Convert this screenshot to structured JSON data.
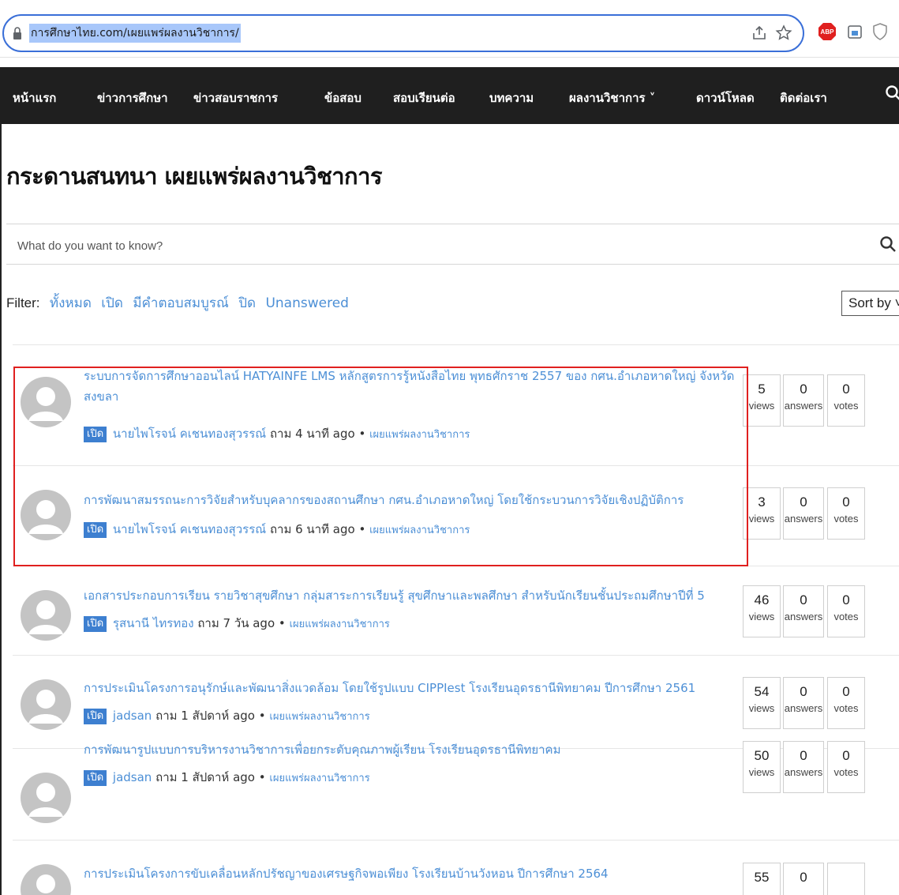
{
  "browser": {
    "url": "การศึกษาไทย.com/เผยแพร่ผลงานวิชาการ/",
    "icons": [
      "lock-icon",
      "share-icon",
      "star-icon",
      "adblock-icon",
      "extension-icon",
      "shield-icon"
    ]
  },
  "nav": {
    "items": [
      "หน้าแรก",
      "ข่าวการศึกษา",
      "ข่าวสอบราชการ",
      "ข้อสอบ",
      "สอบเรียนต่อ",
      "บทความ",
      "ผลงานวิชาการ ˅",
      "ดาวน์โหลด",
      "ติดต่อเรา"
    ]
  },
  "page": {
    "title": "กระดานสนทนา เผยแพร่ผลงานวิชาการ"
  },
  "search": {
    "placeholder": "What do you want to know?"
  },
  "filter": {
    "label": "Filter:",
    "options": [
      "ทั้งหมด",
      "เปิด",
      "มีคำตอบสมบูรณ์",
      "ปิด",
      "Unanswered"
    ],
    "sort_label": "Sort by ˅"
  },
  "questions": [
    {
      "title": "ระบบการจัดการศึกษาออนไลน์ HATYAINFE LMS หลักสูตรการรู้หนังสือไทย พุทธศักราช 2557 ของ กศน.อำเภอหาดใหญ่ จังหวัดสงขลา",
      "status": "เปิด",
      "author": "นายไพโรจน์ คเชนทองสุวรรณ์",
      "asked": "ถาม 4 นาที ago",
      "category": "เผยแพร่ผลงานวิชาการ",
      "views": "5",
      "answers": "0",
      "votes": "0"
    },
    {
      "title": "การพัฒนาสมรรถนะการวิจัยสำหรับบุคลากรของสถานศึกษา กศน.อำเภอหาดใหญ่ โดยใช้กระบวนการวิจัยเชิงปฏิบัติการ",
      "status": "เปิด",
      "author": "นายไพโรจน์ คเชนทองสุวรรณ์",
      "asked": "ถาม 6 นาที ago",
      "category": "เผยแพร่ผลงานวิชาการ",
      "views": "3",
      "answers": "0",
      "votes": "0"
    },
    {
      "title": "เอกสารประกอบการเรียน รายวิชาสุขศึกษา กลุ่มสาระการเรียนรู้ สุขศึกษาและพลศึกษา สำหรับนักเรียนชั้นประถมศึกษาปีที่ 5",
      "status": "เปิด",
      "author": "รุสนานี ไทรทอง",
      "asked": "ถาม 7 วัน ago",
      "category": "เผยแพร่ผลงานวิชาการ",
      "views": "46",
      "answers": "0",
      "votes": "0"
    },
    {
      "title": "การประเมินโครงการอนุรักษ์และพัฒนาสิ่งแวดล้อม โดยใช้รูปแบบ CIPPIest โรงเรียนอุดรธานีพิทยาคม ปีการศึกษา 2561",
      "status": "เปิด",
      "author": "jadsan",
      "asked": "ถาม 1 สัปดาห์ ago",
      "category": "เผยแพร่ผลงานวิชาการ",
      "views": "54",
      "answers": "0",
      "votes": "0"
    },
    {
      "title": "การพัฒนารูปแบบการบริหารงานวิชาการเพื่อยกระดับคุณภาพผู้เรียน โรงเรียนอุดรธานีพิทยาคม",
      "status": "เปิด",
      "author": "jadsan",
      "asked": "ถาม 1 สัปดาห์ ago",
      "category": "เผยแพร่ผลงานวิชาการ",
      "views": "50",
      "answers": "0",
      "votes": "0"
    },
    {
      "title": "การประเมินโครงการขับเคลื่อนหลักปรัชญาของเศรษฐกิจพอเพียง โรงเรียนบ้านวังหอน ปีการศึกษา 2564",
      "views": "55",
      "answers": "0"
    }
  ],
  "stat_labels": {
    "views": "views",
    "answers": "answers",
    "votes": "votes"
  },
  "colors": {
    "accent": "#4c8fd6",
    "badge": "#3d7fd0",
    "navbar": "#1f1f1f",
    "highlight": "#e0201f"
  }
}
